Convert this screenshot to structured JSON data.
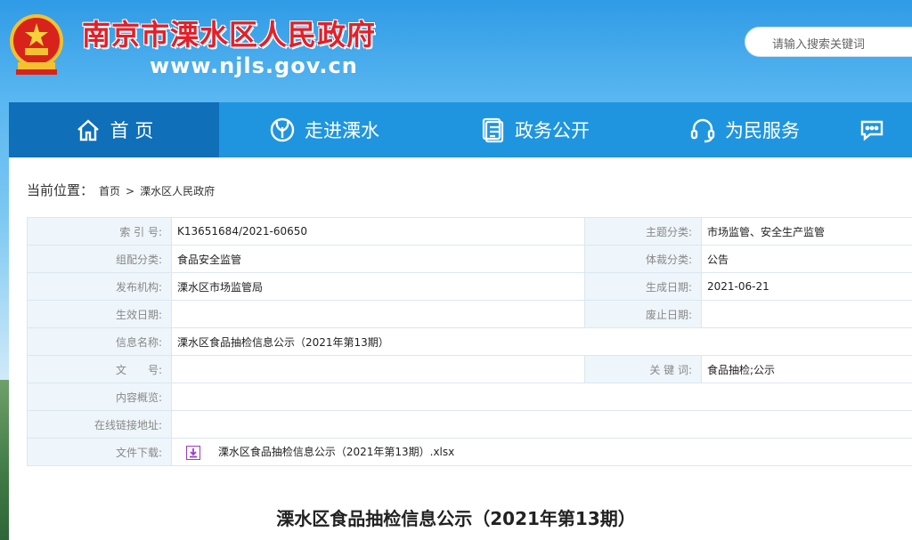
{
  "header": {
    "site_name": "南京市溧水区人民政府",
    "site_url": "www.njls.gov.cn",
    "search_placeholder": "请输入搜索关键词"
  },
  "nav": {
    "items": [
      {
        "label": "首 页",
        "icon": "home-icon",
        "active": true
      },
      {
        "label": "走进溧水",
        "icon": "leaf-icon",
        "active": false
      },
      {
        "label": "政务公开",
        "icon": "document-icon",
        "active": false
      },
      {
        "label": "为民服务",
        "icon": "headset-icon",
        "active": false
      },
      {
        "label": "",
        "icon": "chat-icon",
        "active": false
      }
    ]
  },
  "breadcrumb": {
    "label": "当前位置：",
    "items": [
      "首页",
      ">",
      "溧水区人民政府"
    ]
  },
  "meta": {
    "index_label": "索 引 号:",
    "index_value": "K13651684/2021-60650",
    "topic_label": "主题分类:",
    "topic_value": "市场监管、安全生产监管",
    "org_cat_label": "组配分类:",
    "org_cat_value": "食品安全监管",
    "genre_label": "体裁分类:",
    "genre_value": "公告",
    "publisher_label": "发布机构:",
    "publisher_value": "溧水区市场监管局",
    "created_label": "生成日期:",
    "created_value": "2021-06-21",
    "effective_label": "生效日期:",
    "effective_value": "",
    "expire_label": "废止日期:",
    "expire_value": "",
    "name_label": "信息名称:",
    "name_value": "溧水区食品抽检信息公示（2021年第13期）",
    "docno_label": "文　　号:",
    "docno_value": "",
    "keywords_label": "关 键 词:",
    "keywords_value": "食品抽检;公示",
    "summary_label": "内容概览:",
    "summary_value": "",
    "link_label": "在线链接地址:",
    "link_value": "",
    "download_label": "文件下载:",
    "download_file": "溧水区食品抽检信息公示（2021年第13期）.xlsx"
  },
  "article": {
    "title": "溧水区食品抽检信息公示（2021年第13期）"
  }
}
